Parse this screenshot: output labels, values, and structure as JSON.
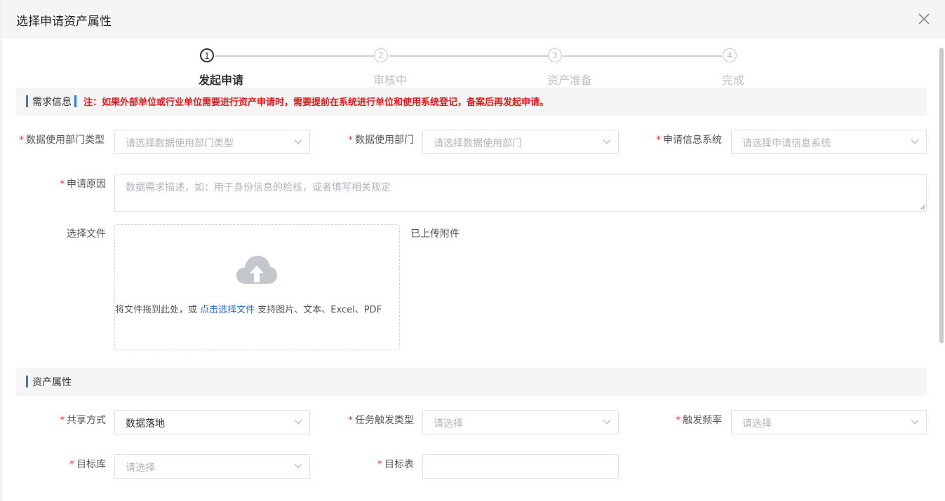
{
  "dialog": {
    "title": "选择申请资产属性"
  },
  "steps": [
    {
      "num": "1",
      "label": "发起申请",
      "state": "active"
    },
    {
      "num": "2",
      "label": "审核中",
      "state": "idle"
    },
    {
      "num": "3",
      "label": "资产准备",
      "state": "idle"
    },
    {
      "num": "4",
      "label": "完成",
      "state": "idle"
    }
  ],
  "demand_section": {
    "title": "需求信息",
    "notice": "注：如果外部单位或行业单位需要进行资产申请时，需要提前在系统进行单位和使用系统登记，备案后再发起申请。"
  },
  "fields": {
    "dept_type": {
      "label": "数据使用部门类型",
      "placeholder": "请选择数据使用部门类型"
    },
    "dept": {
      "label": "数据使用部门",
      "placeholder": "请选择数据使用部门"
    },
    "info_system": {
      "label": "申请信息系统",
      "placeholder": "请选择申请信息系统"
    },
    "reason": {
      "label": "申请原因",
      "placeholder": "数据需求描述，如：用于身份信息的检核，或者填写相关规定"
    },
    "file": {
      "label": "选择文件",
      "drag_text": "将文件拖到此处，或 ",
      "link_text": "点击选择文件",
      "support_text": " 支持图片、文本、Excel、PDF",
      "uploaded_label": "已上传附件"
    }
  },
  "asset_section": {
    "title": "资产属性"
  },
  "asset_fields": {
    "share_mode": {
      "label": "共享方式",
      "value": "数据落地"
    },
    "trigger_type": {
      "label": "任务触发类型",
      "placeholder": "请选择"
    },
    "trigger_freq": {
      "label": "触发频率",
      "placeholder": "请选择"
    },
    "target_db": {
      "label": "目标库",
      "placeholder": "请选择"
    },
    "target_table": {
      "label": "目标表",
      "value": ""
    }
  },
  "required_mark": "*",
  "colors": {
    "accent": "#2f7cd8",
    "notice": "#e0191d",
    "required": "#f04040",
    "link": "#2f6fc4"
  }
}
